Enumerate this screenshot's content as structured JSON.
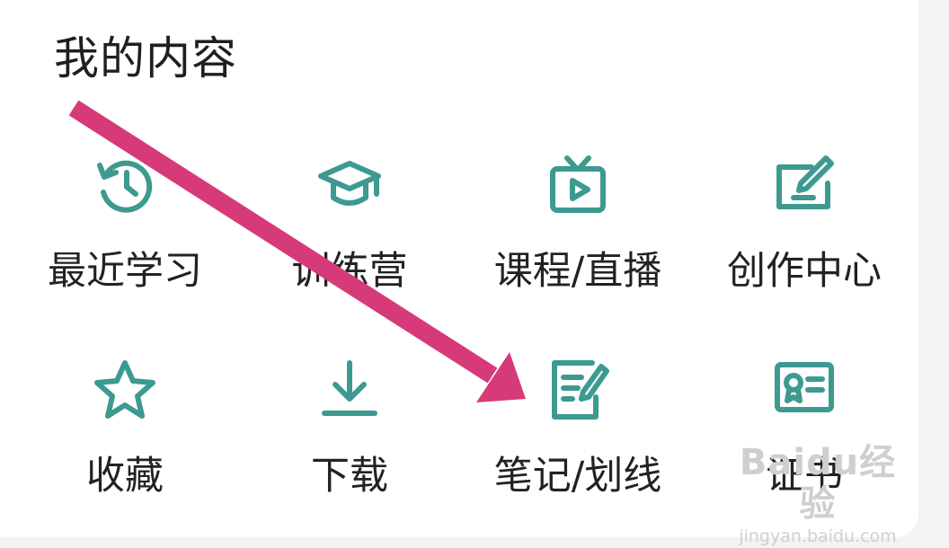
{
  "section": {
    "title": "我的内容"
  },
  "items": [
    {
      "label": "最近学习",
      "icon": "history-clock-icon"
    },
    {
      "label": "训练营",
      "icon": "graduation-cap-icon"
    },
    {
      "label": "课程/直播",
      "icon": "tv-play-icon"
    },
    {
      "label": "创作中心",
      "icon": "edit-square-icon"
    },
    {
      "label": "收藏",
      "icon": "star-icon"
    },
    {
      "label": "下载",
      "icon": "download-icon"
    },
    {
      "label": "笔记/划线",
      "icon": "note-pen-icon"
    },
    {
      "label": "证书",
      "icon": "certificate-icon"
    }
  ],
  "colors": {
    "icon": "#3d9a90",
    "arrow": "#d63a78",
    "text": "#222222"
  },
  "watermark": {
    "logo": "Baidu经验",
    "url": "jingyan.baidu.com"
  }
}
